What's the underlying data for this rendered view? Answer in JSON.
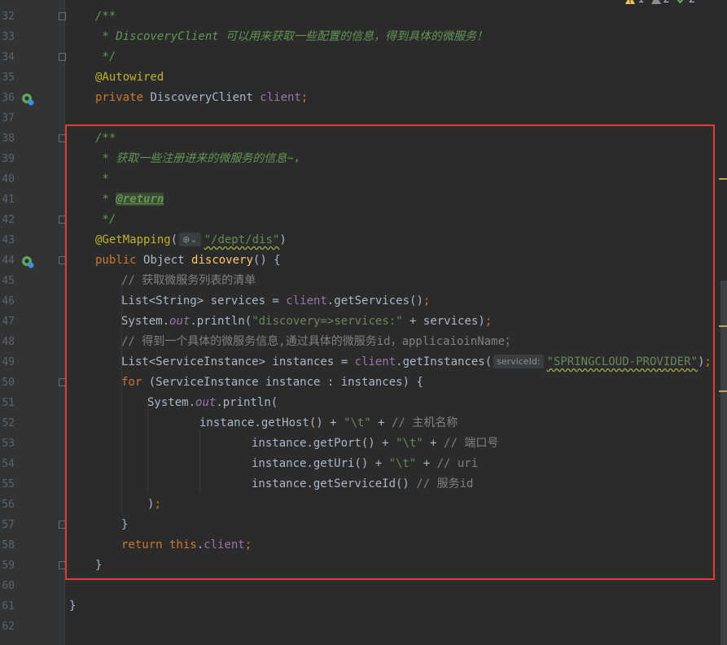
{
  "editor": {
    "inspections": {
      "warnings": "1",
      "weak_warnings": "2",
      "typos": "2"
    },
    "lines": [
      {
        "num": "32",
        "fold": true,
        "parts": [
          [
            "doc",
            "/**"
          ]
        ],
        "indent": 1
      },
      {
        "num": "33",
        "parts": [
          [
            "doc",
            " * DiscoveryClient 可以用来获取一些配置的信息，得到具体的微服务！"
          ]
        ],
        "indent": 1
      },
      {
        "num": "34",
        "fold": true,
        "parts": [
          [
            "doc",
            " */"
          ]
        ],
        "indent": 1
      },
      {
        "num": "35",
        "parts": [
          [
            "ann",
            "@Autowired"
          ]
        ],
        "indent": 1
      },
      {
        "num": "36",
        "icon": "bean-navigate-icon",
        "parts": [
          [
            "kw",
            "private "
          ],
          [
            "plain",
            "DiscoveryClient "
          ],
          [
            "fld",
            "client"
          ],
          [
            "kw",
            ";"
          ]
        ],
        "indent": 1
      },
      {
        "num": "37",
        "parts": [],
        "indent": 1
      },
      {
        "num": "38",
        "fold": true,
        "parts": [
          [
            "doc",
            "/**"
          ]
        ],
        "indent": 1
      },
      {
        "num": "39",
        "parts": [
          [
            "doc",
            " * 获取一些注册进来的微服务的信息~，"
          ]
        ],
        "indent": 1
      },
      {
        "num": "40",
        "parts": [
          [
            "doc",
            " *"
          ]
        ],
        "indent": 1
      },
      {
        "num": "41",
        "parts": [
          [
            "doc",
            " * "
          ],
          [
            "doctag",
            "@return"
          ]
        ],
        "indent": 1
      },
      {
        "num": "42",
        "fold": true,
        "parts": [
          [
            "doc",
            " */"
          ]
        ],
        "indent": 1
      },
      {
        "num": "43",
        "parts": [
          [
            "ann",
            "@GetMapping"
          ],
          [
            "plain",
            "("
          ],
          [
            "hint",
            "⊕⌄"
          ],
          [
            "str",
            "\"/dept/dis\""
          ],
          [
            "plain",
            ")"
          ]
        ],
        "indent": 1
      },
      {
        "num": "44",
        "icon": "endpoint-icon",
        "fold": true,
        "parts": [
          [
            "kw",
            "public "
          ],
          [
            "plain",
            "Object "
          ],
          [
            "fn",
            "discovery"
          ],
          [
            "plain",
            "() {"
          ]
        ],
        "indent": 1
      },
      {
        "num": "45",
        "parts": [
          [
            "cmt",
            "// 获取微服务列表的清单"
          ]
        ],
        "indent": 2
      },
      {
        "num": "46",
        "parts": [
          [
            "plain",
            "List<String> services = "
          ],
          [
            "fld",
            "client"
          ],
          [
            "plain",
            ".getServices()"
          ],
          [
            "kw",
            ";"
          ]
        ],
        "indent": 2
      },
      {
        "num": "47",
        "parts": [
          [
            "plain",
            "System."
          ],
          [
            "sfld",
            "out"
          ],
          [
            "plain",
            ".println("
          ],
          [
            "str",
            "\"discovery=>services:\""
          ],
          [
            "plain",
            " + services)"
          ],
          [
            "kw",
            ";"
          ]
        ],
        "indent": 2
      },
      {
        "num": "48",
        "parts": [
          [
            "cmt",
            "// 得到一个具体的微服务信息,通过具体的微服务id，applicaioinName；"
          ]
        ],
        "indent": 2
      },
      {
        "num": "49",
        "parts": [
          [
            "plain",
            "List<ServiceInstance> instances = "
          ],
          [
            "fld",
            "client"
          ],
          [
            "plain",
            ".getInstances("
          ],
          [
            "hint",
            "serviceId:"
          ],
          [
            "str",
            "\"SPRINGCLOUD-PROVIDER\""
          ],
          [
            "plain",
            ")"
          ],
          [
            "kw",
            ";"
          ]
        ],
        "indent": 2
      },
      {
        "num": "50",
        "fold": true,
        "parts": [
          [
            "kw",
            "for "
          ],
          [
            "plain",
            "(ServiceInstance instance : instances) {"
          ]
        ],
        "indent": 2
      },
      {
        "num": "51",
        "parts": [
          [
            "plain",
            "System."
          ],
          [
            "sfld",
            "out"
          ],
          [
            "plain",
            ".println("
          ]
        ],
        "indent": 3
      },
      {
        "num": "52",
        "parts": [
          [
            "plain",
            "instance.getHost() + "
          ],
          [
            "str",
            "\"\\t\""
          ],
          [
            "plain",
            " + "
          ],
          [
            "cmt",
            "// 主机名称"
          ]
        ],
        "indent": 5
      },
      {
        "num": "53",
        "parts": [
          [
            "plain",
            "instance.getPort() + "
          ],
          [
            "str",
            "\"\\t\""
          ],
          [
            "plain",
            " + "
          ],
          [
            "cmt",
            "// 端口号"
          ]
        ],
        "indent": 7
      },
      {
        "num": "54",
        "parts": [
          [
            "plain",
            "instance.getUri() + "
          ],
          [
            "str",
            "\"\\t\""
          ],
          [
            "plain",
            " + "
          ],
          [
            "cmt",
            "// uri"
          ]
        ],
        "indent": 7
      },
      {
        "num": "55",
        "parts": [
          [
            "plain",
            "instance.getServiceId() "
          ],
          [
            "cmt",
            "// 服务id"
          ]
        ],
        "indent": 7
      },
      {
        "num": "56",
        "parts": [
          [
            "plain",
            ")"
          ],
          [
            "kw",
            ";"
          ]
        ],
        "indent": 3
      },
      {
        "num": "57",
        "fold": true,
        "parts": [
          [
            "plain",
            "}"
          ]
        ],
        "indent": 2
      },
      {
        "num": "58",
        "parts": [
          [
            "kw",
            "return this"
          ],
          [
            "plain",
            "."
          ],
          [
            "fld",
            "client"
          ],
          [
            "kw",
            ";"
          ]
        ],
        "indent": 2
      },
      {
        "num": "59",
        "fold": true,
        "parts": [
          [
            "plain",
            "}"
          ]
        ],
        "indent": 1
      },
      {
        "num": "60",
        "parts": [],
        "indent": 1
      },
      {
        "num": "61",
        "parts": [
          [
            "plain",
            "}"
          ]
        ],
        "indent": 0
      },
      {
        "num": "62",
        "parts": [],
        "indent": 0
      }
    ]
  }
}
